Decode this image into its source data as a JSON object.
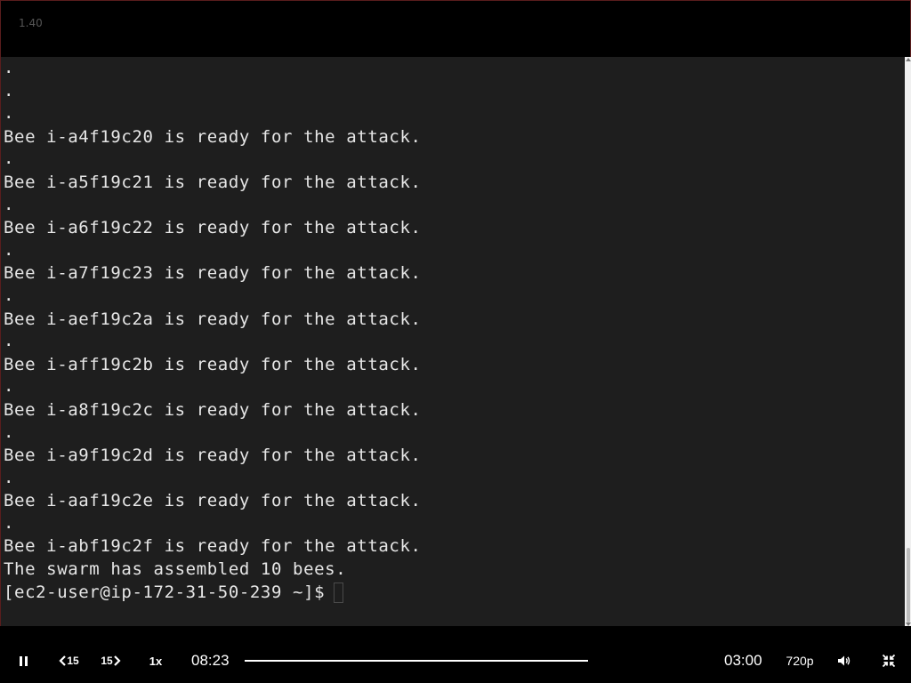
{
  "window": {
    "version": "1.40"
  },
  "terminal": {
    "lines": [
      ".",
      ".",
      ".",
      "Bee i-a4f19c20 is ready for the attack.",
      ".",
      "Bee i-a5f19c21 is ready for the attack.",
      ".",
      "Bee i-a6f19c22 is ready for the attack.",
      ".",
      "Bee i-a7f19c23 is ready for the attack.",
      ".",
      "Bee i-aef19c2a is ready for the attack.",
      ".",
      "Bee i-aff19c2b is ready for the attack.",
      ".",
      "Bee i-a8f19c2c is ready for the attack.",
      ".",
      "Bee i-a9f19c2d is ready for the attack.",
      ".",
      "Bee i-aaf19c2e is ready for the attack.",
      ".",
      "Bee i-abf19c2f is ready for the attack.",
      "The swarm has assembled 10 bees."
    ],
    "prompt": "[ec2-user@ip-172-31-50-239 ~]$"
  },
  "player": {
    "rewind_label": "15",
    "forward_label": "15",
    "speed_label": "1x",
    "elapsed_time": "08:23",
    "remaining_time": "03:00",
    "quality_label": "720p",
    "progress": 1.0,
    "icons": {
      "pause": "pause-icon",
      "rewind": "rewind-15-icon",
      "forward": "forward-15-icon",
      "volume": "volume-icon",
      "fullscreen": "exit-fullscreen-icon"
    }
  },
  "colors": {
    "terminal_bg": "#1e1e1e",
    "terminal_fg": "#e6e6e6",
    "controls_bg": "#000000"
  }
}
